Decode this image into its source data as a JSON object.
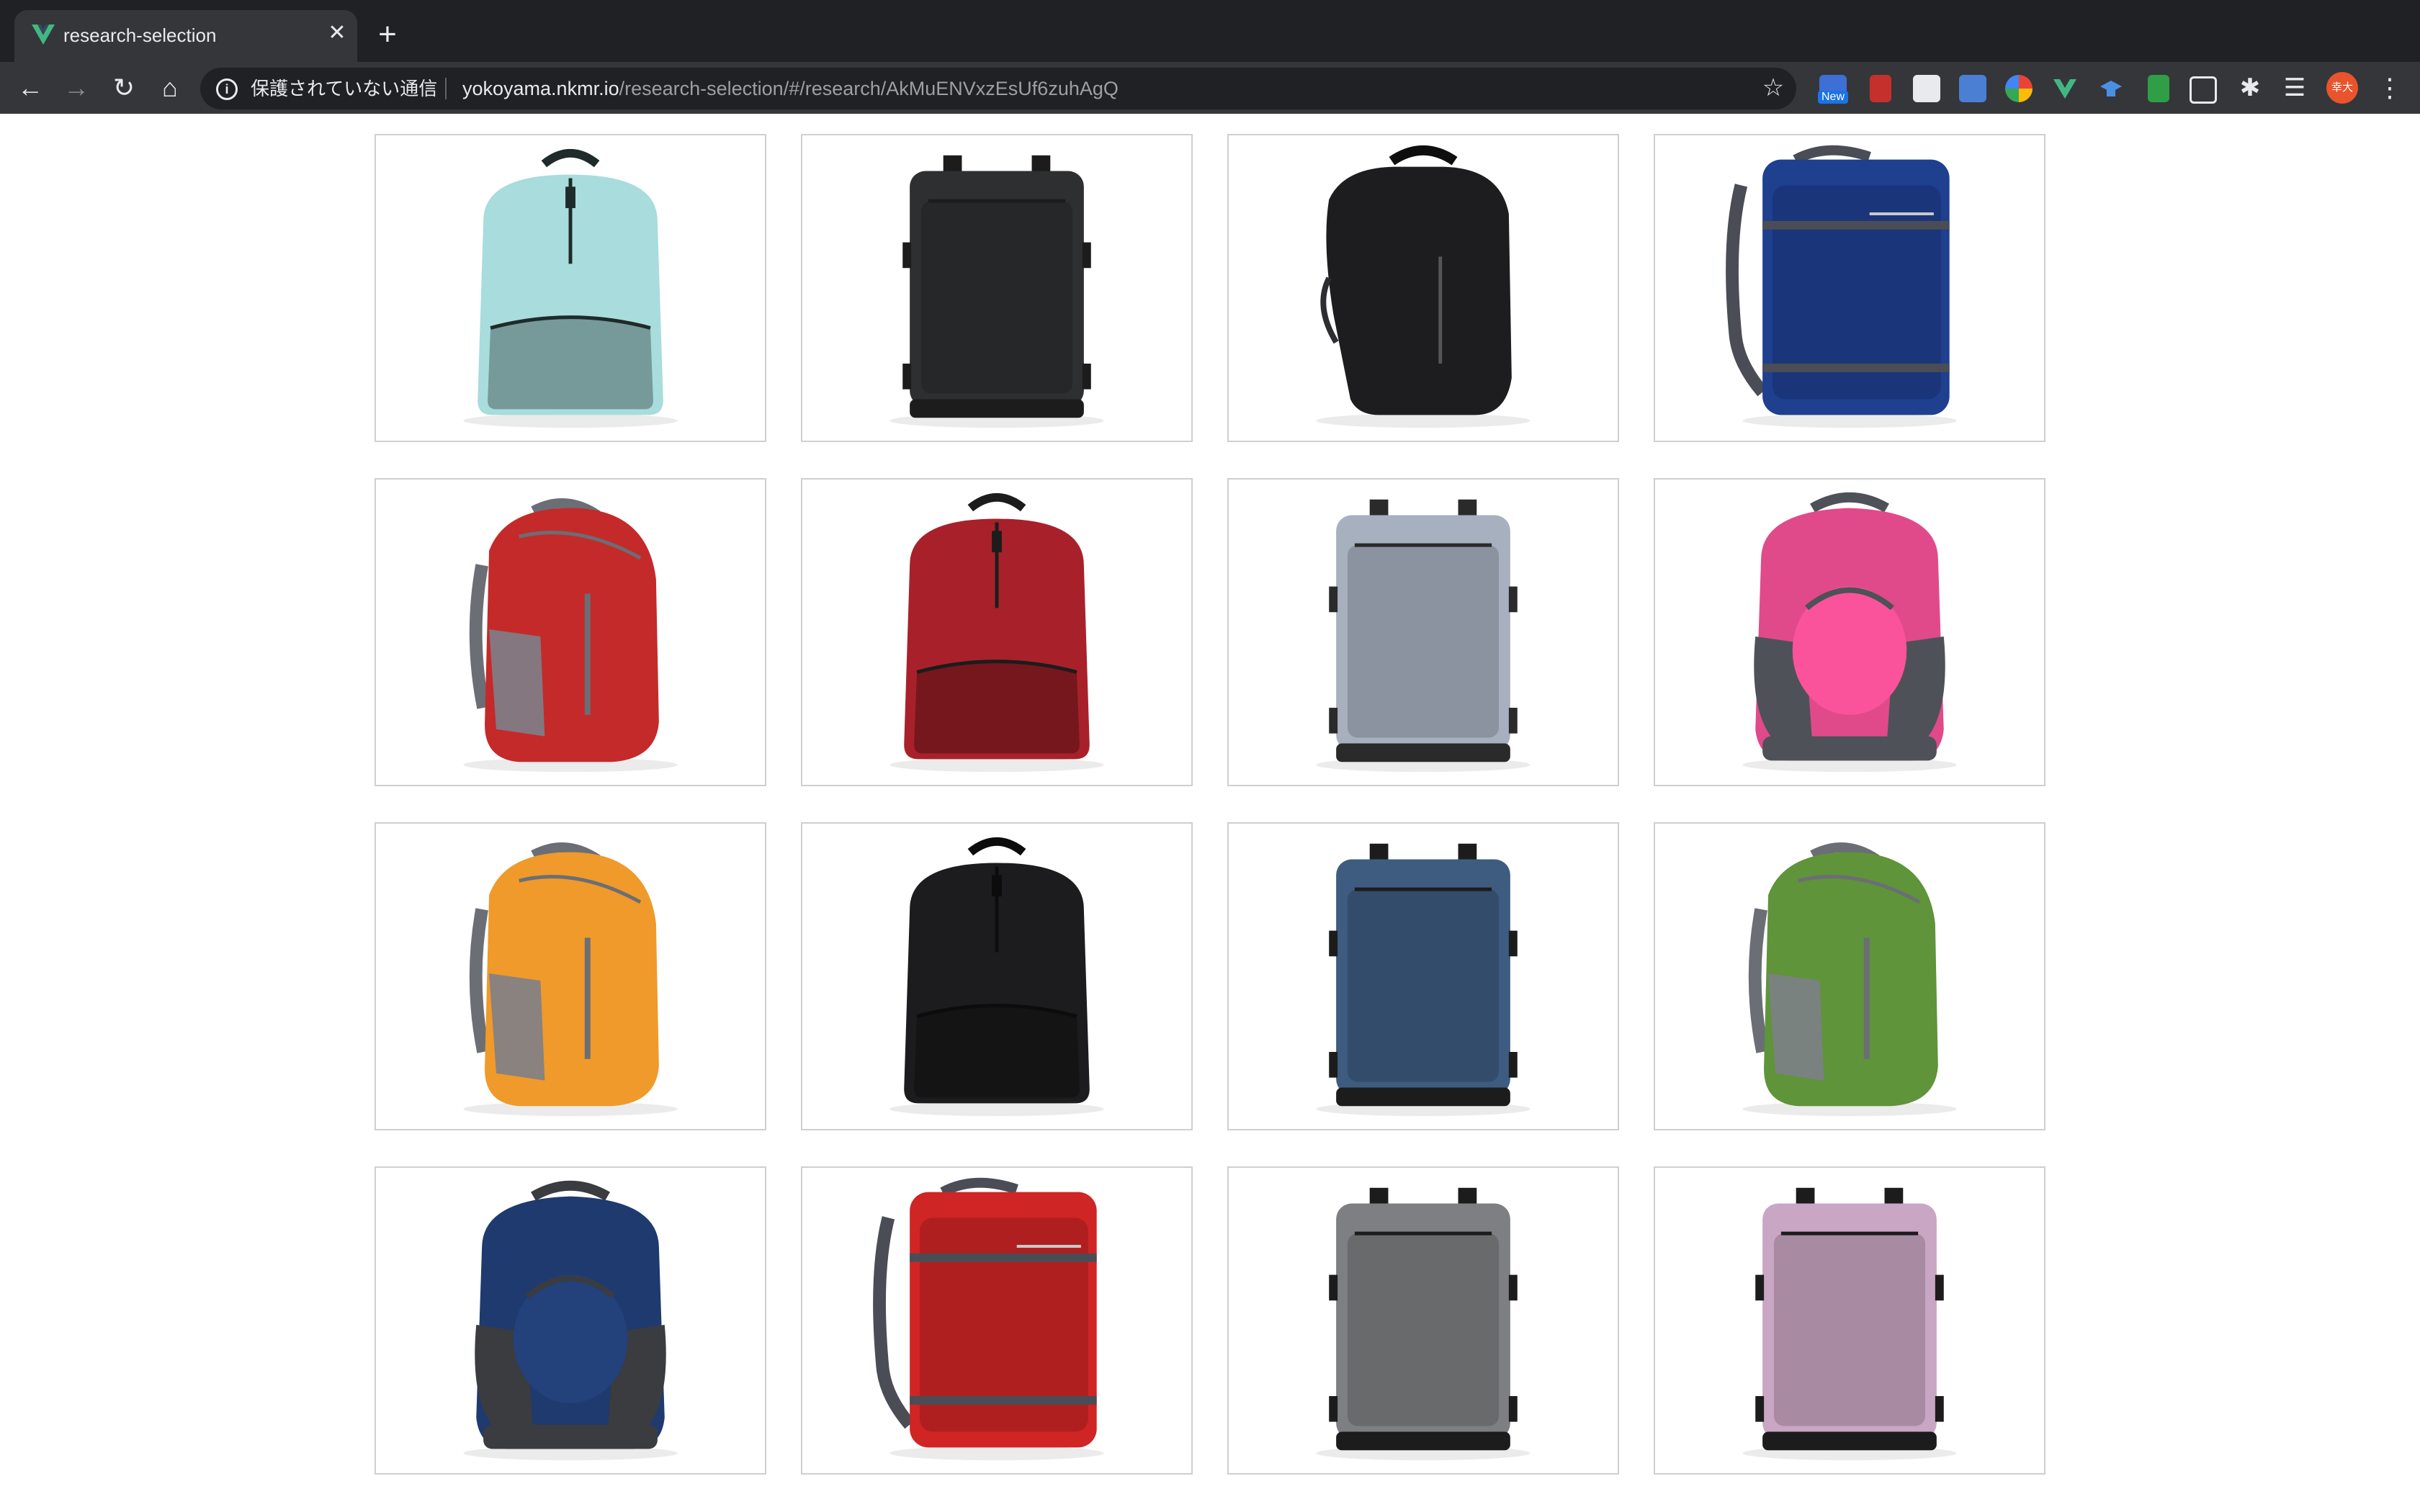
{
  "browser": {
    "tab": {
      "title": "research-selection",
      "favicon": "vue-logo-icon",
      "favicon_color": "#41b883"
    },
    "omnibox": {
      "security_label": "保護されていない通信",
      "url_host": "yokoyama.nkmr.io",
      "url_path": "/research-selection/#/research/AkMuENVxzEsUf6zuhAgQ"
    },
    "extension_new_badge": "New",
    "profile_label": "幸大"
  },
  "products": [
    {
      "name": "light blue daypack",
      "style": "daypack",
      "color": "#a9dcdc",
      "accent": "#1f2a2a"
    },
    {
      "name": "black travel backpack",
      "style": "travel",
      "color": "#2e2f30",
      "accent": "#1c1c1c"
    },
    {
      "name": "black slim backpack",
      "style": "slim",
      "color": "#1d1d1f",
      "accent": "#0e0e0e"
    },
    {
      "name": "navy travel backpack",
      "style": "large",
      "color": "#1f3f8f",
      "accent": "#4a4d55"
    },
    {
      "name": "red packable backpack",
      "style": "packable",
      "color": "#c42a2a",
      "accent": "#6b6e75"
    },
    {
      "name": "red daypack",
      "style": "daypack",
      "color": "#a8212a",
      "accent": "#1c1c1c"
    },
    {
      "name": "gray heather travel backpack",
      "style": "travel",
      "color": "#a7b0bf",
      "accent": "#2a2a2a"
    },
    {
      "name": "pink school backpack",
      "style": "school",
      "color": "#e04a8a",
      "accent": "#4e5258"
    },
    {
      "name": "orange packable backpack",
      "style": "packable",
      "color": "#ef9a2a",
      "accent": "#6b6e75"
    },
    {
      "name": "black daypack",
      "style": "daypack",
      "color": "#1c1c1e",
      "accent": "#0c0c0c"
    },
    {
      "name": "blue heather slim backpack",
      "style": "travel",
      "color": "#3e5c80",
      "accent": "#1c1c1c"
    },
    {
      "name": "green packable backpack",
      "style": "packable",
      "color": "#5f943a",
      "accent": "#6b6e75"
    },
    {
      "name": "navy school backpack",
      "style": "school",
      "color": "#1f3a6e",
      "accent": "#3a3c40"
    },
    {
      "name": "red large travel backpack",
      "style": "large",
      "color": "#cf2525",
      "accent": "#4a4d55"
    },
    {
      "name": "charcoal heather travel backpack",
      "style": "travel",
      "color": "#7e7f82",
      "accent": "#1c1c1c"
    },
    {
      "name": "lavender heather backpack",
      "style": "travel",
      "color": "#c9a6c4",
      "accent": "#1c1c1c"
    }
  ]
}
